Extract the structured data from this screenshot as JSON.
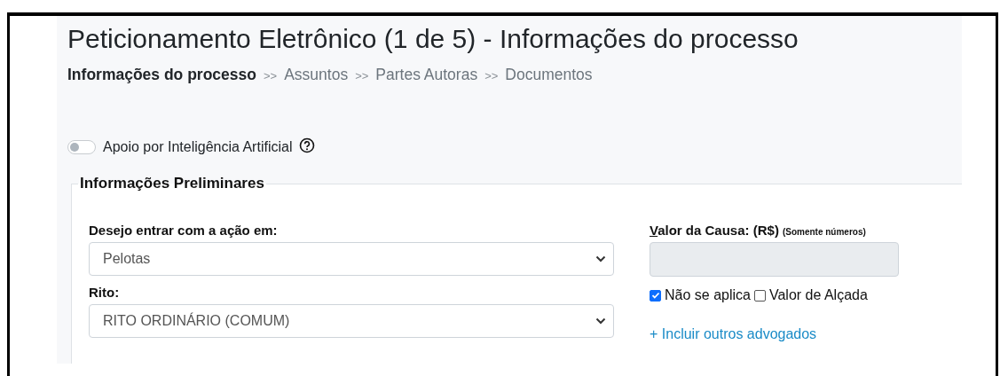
{
  "page": {
    "title": "Peticionamento Eletrônico (1 de 5) - Informações do processo"
  },
  "breadcrumb": [
    {
      "kind": "step",
      "label": "Informações do processo",
      "selected": true
    },
    {
      "kind": "separator",
      "label": ">>"
    },
    {
      "kind": "step",
      "label": "Assuntos",
      "selected": false
    },
    {
      "kind": "separator",
      "label": ">>"
    },
    {
      "kind": "step",
      "label": "Partes Autoras",
      "selected": false
    },
    {
      "kind": "separator",
      "label": ">>"
    },
    {
      "kind": "step",
      "label": "Documentos",
      "selected": false
    }
  ],
  "ai_toggle": {
    "label": "Apoio por Inteligência Artificial",
    "on": false
  },
  "section": {
    "legend": "Informações Preliminares",
    "fields": [
      {
        "label": "Desejo entrar com a ação em:",
        "value": "Pelotas"
      },
      {
        "label": "Rito:",
        "value": "RITO ORDINÁRIO (COMUM)"
      }
    ],
    "value_field": {
      "label": "Valor da Causa: (R$)",
      "hint": "(Somente números)",
      "disabled": true
    },
    "checkboxes": [
      {
        "label": "Não se aplica",
        "checked": true
      },
      {
        "label": "Valor de Alçada",
        "checked": false
      }
    ],
    "link": "+ Incluir outros advogados"
  }
}
